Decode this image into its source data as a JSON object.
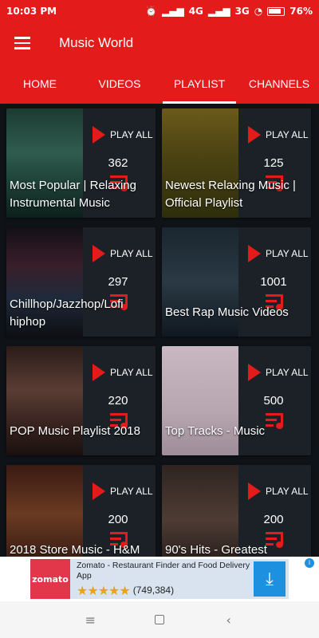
{
  "status": {
    "time": "10:03 PM",
    "network1": "4G",
    "network2": "3G",
    "battery": "76%"
  },
  "app": {
    "title": "Music World"
  },
  "tabs": [
    {
      "label": "HOME",
      "active": false
    },
    {
      "label": "VIDEOS",
      "active": false
    },
    {
      "label": "PLAYLIST",
      "active": true
    },
    {
      "label": "CHANNELS",
      "active": false
    }
  ],
  "playlists": [
    {
      "title": "Most Popular | Relaxing Instrumental Music",
      "count": "362",
      "play_label": "PLAY ALL"
    },
    {
      "title": "Newest Relaxing Music | Official Playlist",
      "count": "125",
      "play_label": "PLAY ALL"
    },
    {
      "title": "Chillhop/Jazzhop/Lofi hiphop",
      "count": "297",
      "play_label": "PLAY ALL"
    },
    {
      "title": "Best Rap Music Videos",
      "count": "1001",
      "play_label": "PLAY ALL"
    },
    {
      "title": "POP Music Playlist 2018",
      "count": "220",
      "play_label": "PLAY ALL"
    },
    {
      "title": "Top Tracks - Music",
      "count": "500",
      "play_label": "PLAY ALL"
    },
    {
      "title": "2018 Store Music - H&M",
      "count": "200",
      "play_label": "PLAY ALL"
    },
    {
      "title": "90's Hits - Greatest",
      "count": "200",
      "play_label": "PLAY ALL"
    }
  ],
  "ad": {
    "logo": "zomato",
    "title": "Zomato - Restaurant Finder and Food Delivery App",
    "rating_count": "(749,384)",
    "stars": "★★★★★"
  },
  "colors": {
    "accent": "#e31b1b",
    "card_bg": "#1b2127"
  }
}
